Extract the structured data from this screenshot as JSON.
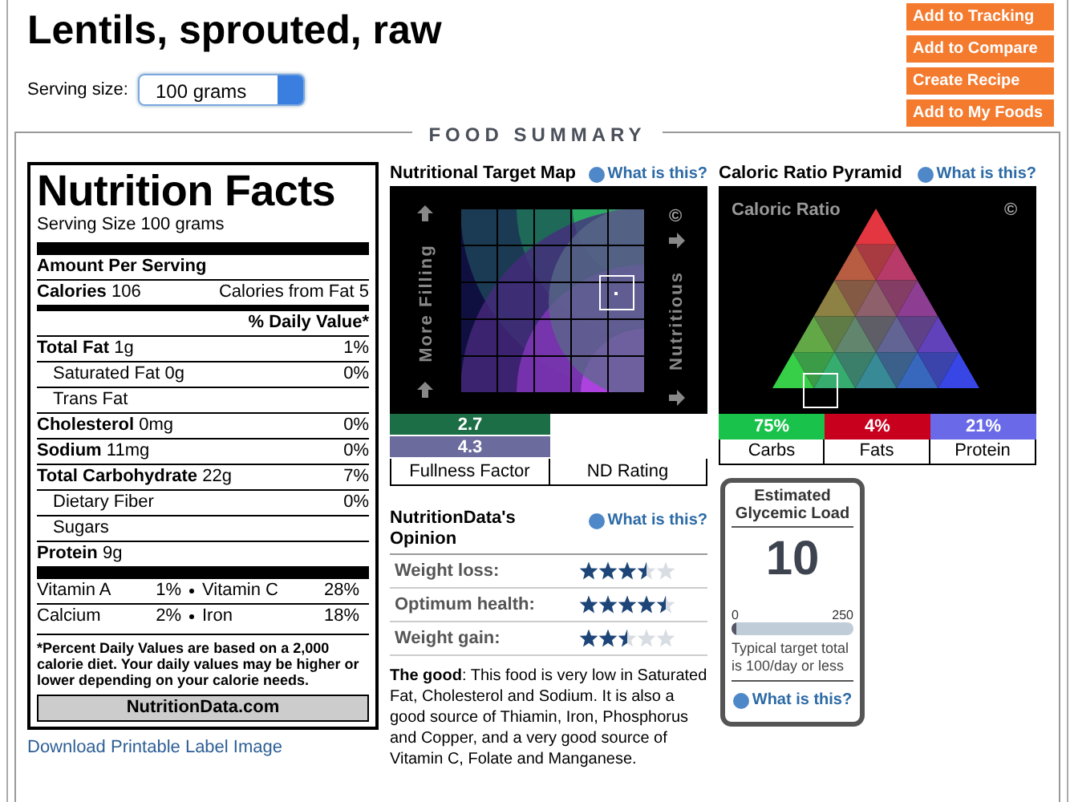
{
  "title": "Lentils, sprouted, raw",
  "serving": {
    "label": "Serving size:",
    "value": "100 grams"
  },
  "actions": [
    "Add to Tracking",
    "Add to Compare",
    "Create Recipe",
    "Add to My Foods"
  ],
  "section_title": "FOOD SUMMARY",
  "label": {
    "title": "Nutrition Facts",
    "serving_size": "Serving Size  100 grams",
    "amount_per_serving": "Amount Per Serving",
    "calories": "**Calories** 106",
    "calories_from_fat": "Calories from Fat 5",
    "dv_heading": "% Daily Value*",
    "nutrients": [
      {
        "name": "**Total Fat** 1g",
        "dv": "1%",
        "children": [
          {
            "name": "Saturated Fat 0g",
            "dv": "0%"
          },
          {
            "name": "Trans Fat"
          }
        ]
      },
      {
        "name": "**Cholesterol** 0mg",
        "dv": "0%"
      },
      {
        "name": "**Sodium** 11mg",
        "dv": "0%"
      },
      {
        "name": "**Total Carbohydrate** 22g",
        "dv": "7%",
        "children": [
          {
            "name": "Dietary Fiber",
            "dv": "0%"
          },
          {
            "name": "Sugars"
          }
        ]
      },
      {
        "name": "**Protein** 9g"
      }
    ],
    "vitamins": [
      [
        {
          "name": "Vitamin A",
          "dv": "1%"
        },
        {
          "name": "Vitamin C",
          "dv": "28%"
        }
      ],
      [
        {
          "name": "Calcium",
          "dv": "2%"
        },
        {
          "name": "Iron",
          "dv": "18%"
        }
      ]
    ],
    "footnote": "*Percent Daily Values are based on a 2,000 calorie diet. Your daily values may be higher or lower depending on your calorie needs.",
    "brand": "NutritionData.com",
    "download_link": "Download Printable Label Image"
  },
  "target_map": {
    "title": "Nutritional Target Map",
    "help": "What is this?",
    "y_axis": "More Filling",
    "x_axis": "Nutritious",
    "copyright": "©",
    "bars": [
      {
        "value": "2.7",
        "color": "#1b6e45"
      },
      {
        "value": "4.3",
        "color": "#6b6b9e"
      }
    ],
    "captions": [
      "Fullness Factor",
      "ND Rating"
    ]
  },
  "opinion": {
    "title": "NutritionData's Opinion",
    "help": "What is this?",
    "ratings": [
      {
        "label": "Weight loss:",
        "stars": 3.5
      },
      {
        "label": "Optimum health:",
        "stars": 4.5
      },
      {
        "label": "Weight gain:",
        "stars": 2.5
      }
    ],
    "summary": "**The good**: This food is very low in Saturated Fat, Cholesterol and Sodium. It is also a good source of Thiamin, Iron, Phosphorus and Copper, and a very good source of Vitamin C, Folate and Manganese."
  },
  "pyramid": {
    "title": "Caloric Ratio Pyramid",
    "help": "What is this?",
    "inner_title": "Caloric Ratio",
    "copyright": "©",
    "parts": [
      {
        "value": "75%",
        "label": "Carbs",
        "color": "#19c24a"
      },
      {
        "value": "4%",
        "label": "Fats",
        "color": "#c8001e"
      },
      {
        "value": "21%",
        "label": "Protein",
        "color": "#6a6ae8"
      }
    ]
  },
  "glycemic": {
    "title": "Estimated Glycemic Load",
    "value": "10",
    "scale_min": "0",
    "scale_max": "250",
    "level": 0.04,
    "note": "Typical target total is 100/day or less",
    "help": "What is this?"
  }
}
